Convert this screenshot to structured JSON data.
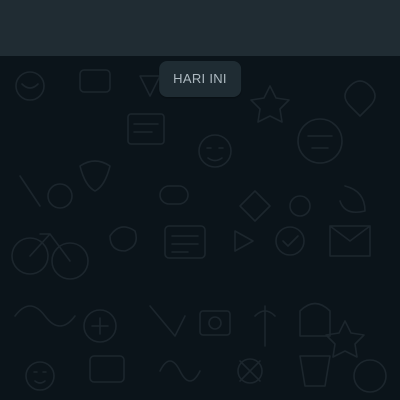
{
  "header": {
    "background": "#202c33"
  },
  "chat": {
    "background": "#0b141a",
    "doodle_color": "#1c262d",
    "date_divider": "HARI INI"
  }
}
